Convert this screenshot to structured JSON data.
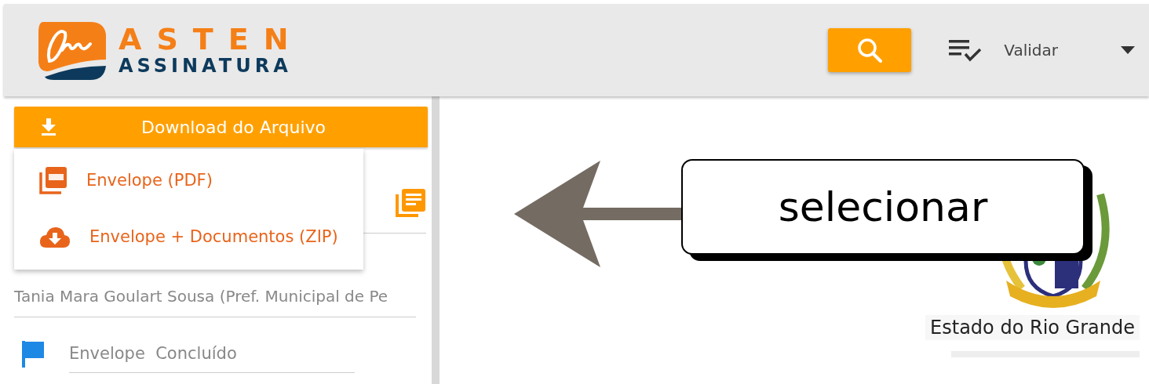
{
  "header": {
    "logo": {
      "title": "ASTEN",
      "subtitle": "ASSINATURA"
    },
    "validate_menu": {
      "label": "Validar"
    }
  },
  "download": {
    "label": "Download do Arquivo",
    "expanded": true,
    "options": [
      {
        "label": "Envelope (PDF)",
        "kind": "pdf"
      },
      {
        "label": "Envelope + Documentos (ZIP)",
        "kind": "zip"
      }
    ]
  },
  "details": {
    "owner": "Tania Mara Goulart Sousa (Pref. Municipal de Pe",
    "status": "Envelope  Concluído"
  },
  "document": {
    "heading": "Estado do Rio Grande"
  },
  "annotation": {
    "text": "selecionar"
  }
}
